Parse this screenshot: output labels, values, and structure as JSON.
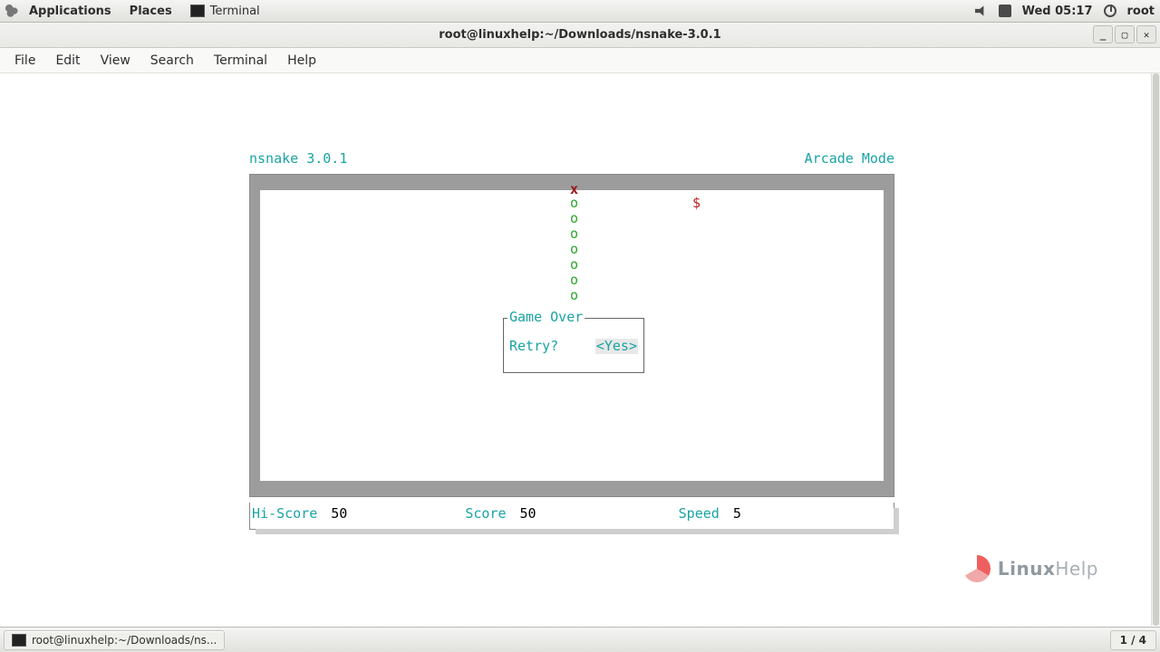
{
  "panel": {
    "applications": "Applications",
    "places": "Places",
    "running_app": "Terminal",
    "clock": "Wed 05:17",
    "user": "root"
  },
  "window": {
    "title": "root@linuxhelp:~/Downloads/nsnake-3.0.1"
  },
  "menubar": [
    "File",
    "Edit",
    "View",
    "Search",
    "Terminal",
    "Help"
  ],
  "game": {
    "name": "nsnake 3.0.1",
    "mode": "Arcade Mode",
    "gameover_title": "Game Over",
    "retry_prompt": "Retry?",
    "retry_yes": "<Yes>",
    "snake_head_glyph": "x",
    "snake_body_glyph": "o",
    "food_glyph": "$",
    "snake": {
      "head": {
        "col": 38,
        "row": 0
      },
      "body_rows": [
        1,
        2,
        3,
        4,
        5,
        6,
        7
      ],
      "body_col": 38
    },
    "food": {
      "col": 53,
      "row": 1
    },
    "status": {
      "hiscore_label": "Hi-Score",
      "hiscore_value": "50",
      "score_label": "Score",
      "score_value": "50",
      "speed_label": "Speed",
      "speed_value": "5"
    }
  },
  "taskbar": {
    "item": "root@linuxhelp:~/Downloads/ns..."
  },
  "workspace": "1 / 4",
  "watermark": {
    "brand1": "Linux",
    "brand2": "Help"
  }
}
